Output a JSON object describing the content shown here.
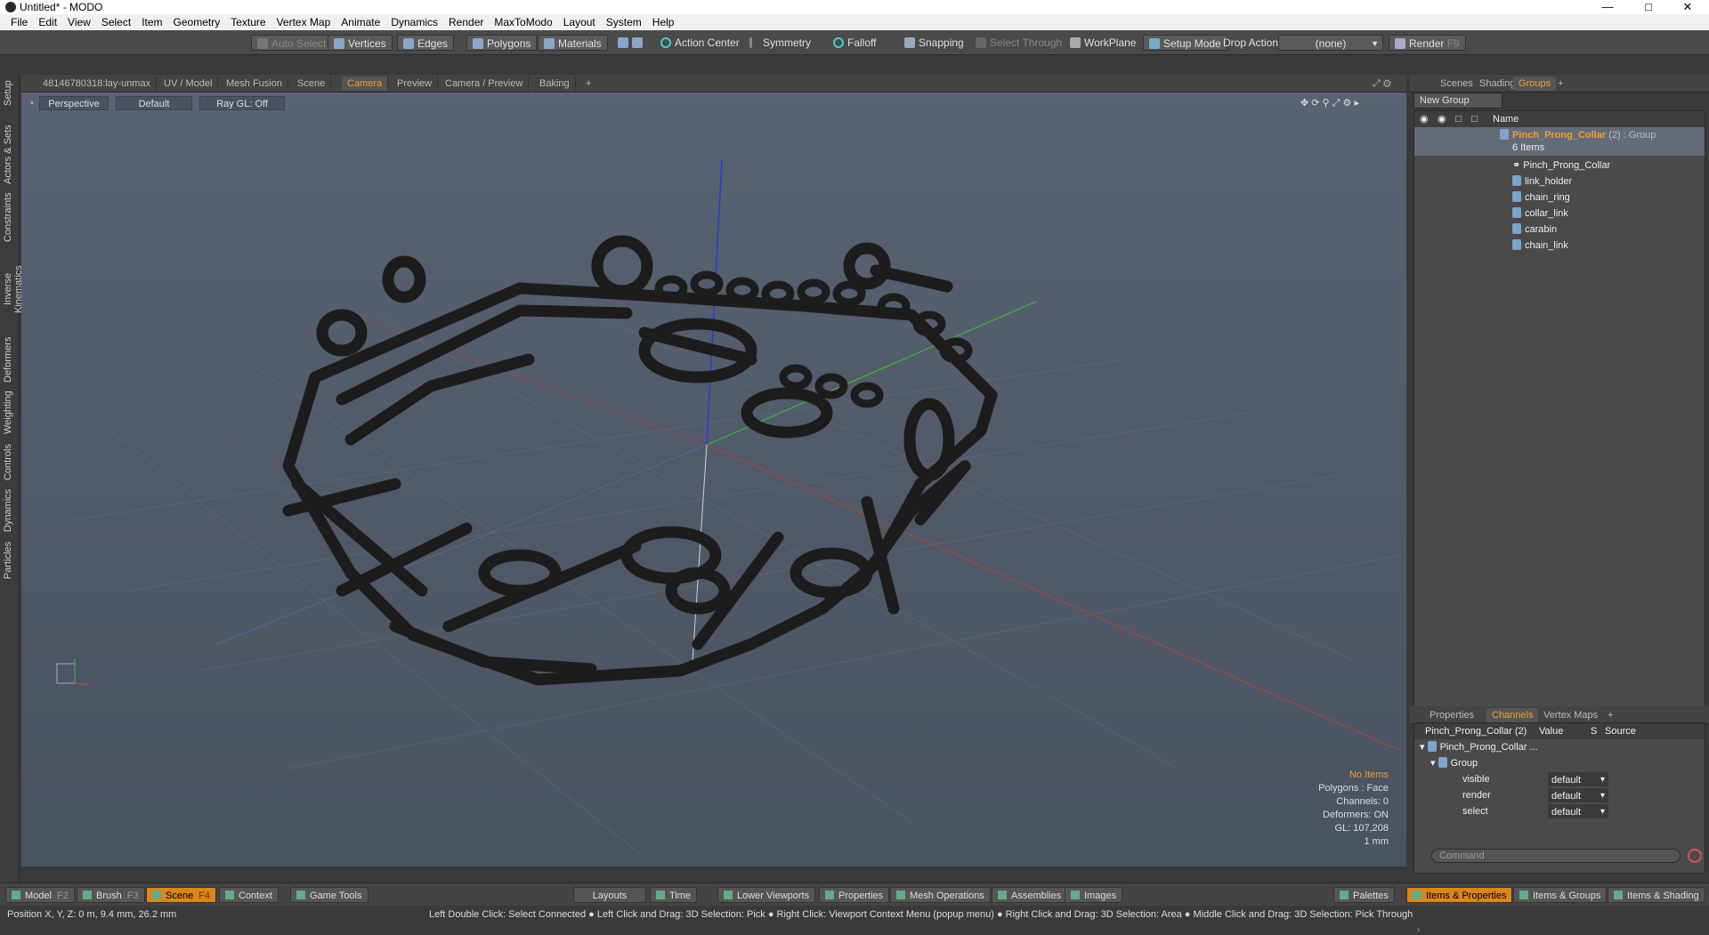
{
  "window": {
    "title": "Untitled* - MODO"
  },
  "menu": [
    "File",
    "Edit",
    "View",
    "Select",
    "Item",
    "Geometry",
    "Texture",
    "Vertex Map",
    "Animate",
    "Dynamics",
    "Render",
    "MaxToModo",
    "Layout",
    "System",
    "Help"
  ],
  "toolbar": {
    "auto_select": "Auto Select",
    "vertices": "Vertices",
    "edges": "Edges",
    "polygons": "Polygons",
    "materials": "Materials",
    "action_center": "Action Center",
    "symmetry": "Symmetry",
    "falloff": "Falloff",
    "snapping": "Snapping",
    "select_through": "Select Through",
    "workplane": "WorkPlane",
    "setup_mode": "Setup Mode",
    "drop_action": "Drop Action",
    "drop_value": "(none)",
    "render": "Render",
    "render_key": "F9"
  },
  "left_tabs": [
    "Setup",
    "Actors & Sets",
    "Constraints",
    "Inverse Kinematics",
    "Deformers",
    "Weighting",
    "Controls",
    "Dynamics",
    "Particles"
  ],
  "viewport_tabs": [
    "48146780318:lay-unmax",
    "UV / Model",
    "Mesh Fusion",
    "Scene",
    "Camera",
    "Preview",
    "Camera / Preview",
    "Baking",
    "+"
  ],
  "viewport_bar": {
    "view": "Perspective",
    "shading": "Default",
    "raygl": "Ray GL: Off"
  },
  "hud": {
    "items": "No Items",
    "polygons": "Polygons : Face",
    "channels": "Channels: 0",
    "deformers": "Deformers: ON",
    "gl": "GL: 107,208",
    "unit": "1 mm"
  },
  "right_tabs": [
    "Scenes",
    "Shading",
    "Groups",
    "+"
  ],
  "groups": {
    "new_group": "New Group",
    "name_header": "Name",
    "group_name": "Pinch_Prong_Collar",
    "group_suffix": "(2) : Group",
    "item_count": "6 Items",
    "items": [
      "Pinch_Prong_Collar",
      "link_holder",
      "chain_ring",
      "collar_link",
      "carabin",
      "chain_link"
    ]
  },
  "prop_tabs": [
    "Properties",
    "Channels",
    "Vertex Maps",
    "+"
  ],
  "channels": {
    "header": "Pinch_Prong_Collar (2)",
    "col_value": "Value",
    "col_s": "S",
    "col_source": "Source",
    "root": "Pinch_Prong_Collar ...",
    "group": "Group",
    "rows": [
      {
        "name": "visible",
        "value": "default"
      },
      {
        "name": "render",
        "value": "default"
      },
      {
        "name": "select",
        "value": "default"
      }
    ]
  },
  "command_placeholder": "Command",
  "bottom": {
    "model": "Model",
    "model_key": "F2",
    "brush": "Brush",
    "brush_key": "F3",
    "scene": "Scene",
    "scene_key": "F4",
    "context": "Context",
    "game_tools": "Game Tools",
    "layouts": "Layouts",
    "time": "Time",
    "lower_viewports": "Lower Viewports",
    "properties": "Properties",
    "mesh_ops": "Mesh Operations",
    "assemblies": "Assemblies",
    "images": "Images",
    "palettes": "Palettes",
    "items_props": "Items & Properties",
    "items_groups": "Items & Groups",
    "items_shading": "Items & Shading"
  },
  "status": {
    "position": "Position X, Y, Z:   0 m, 9.4 mm, 26.2 mm",
    "hints": "Left Double Click: Select Connected ● Left Click and Drag: 3D Selection: Pick ● Right Click: Viewport Context Menu (popup menu) ● Right Click and Drag: 3D Selection: Area ● Middle Click and Drag: 3D Selection: Pick Through"
  }
}
